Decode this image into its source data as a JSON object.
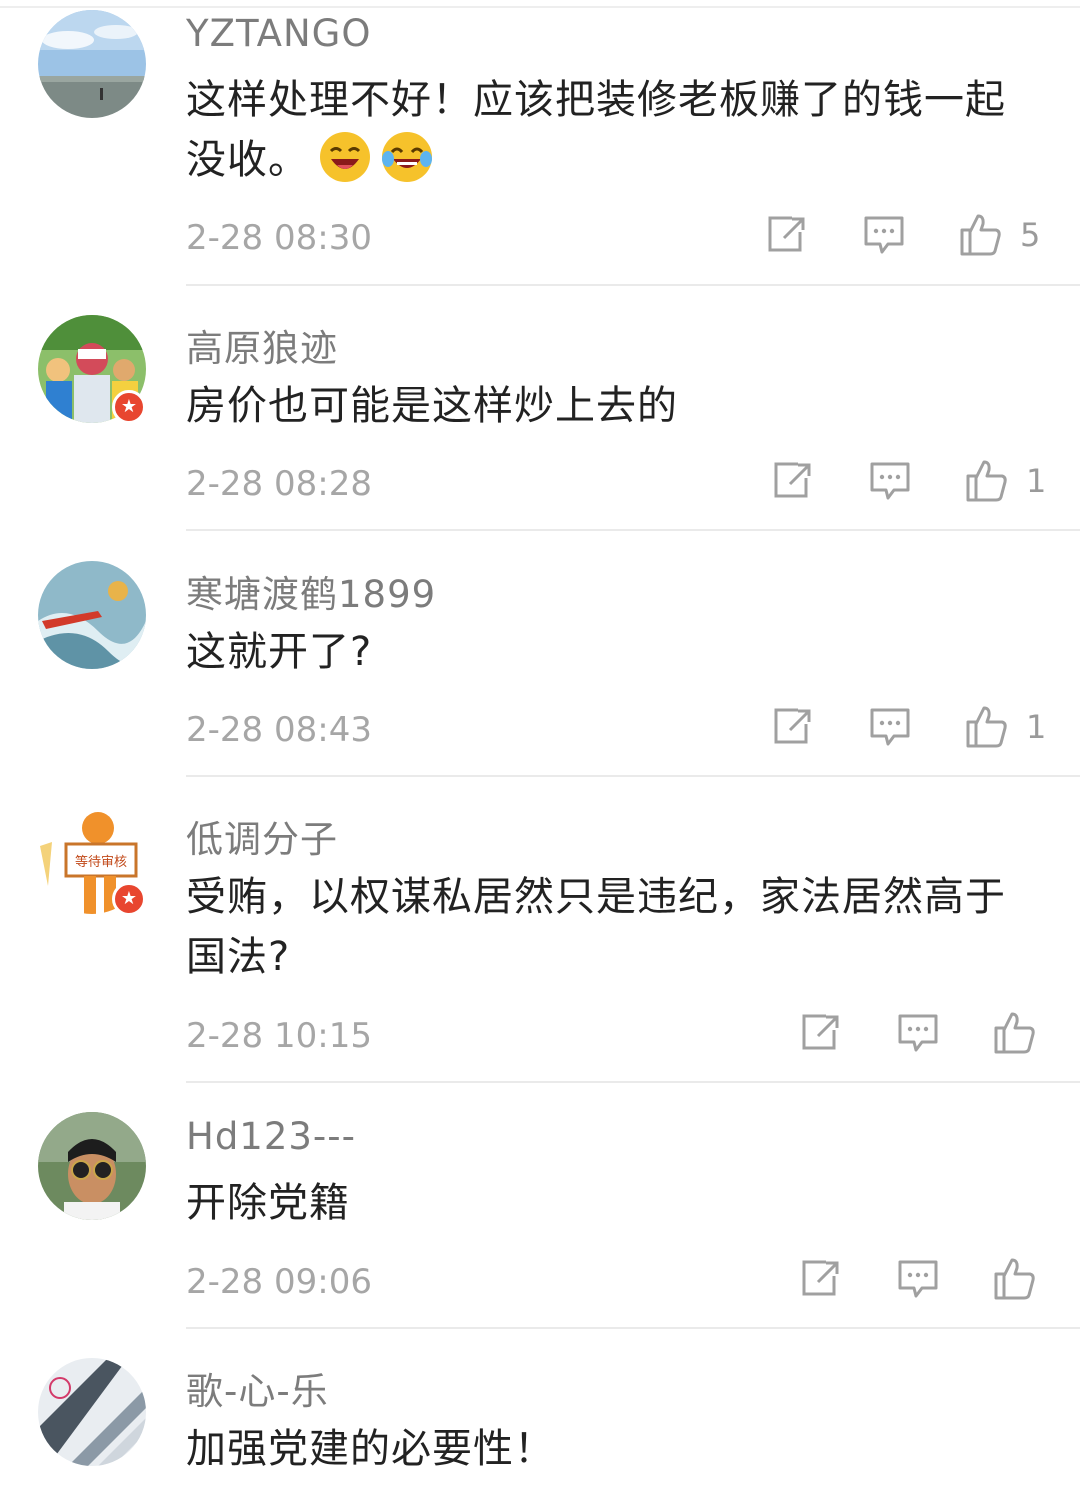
{
  "comments": [
    {
      "username": "YZTANGO",
      "text": "这样处理不好！应该把装修老板赚了的钱一起没收。",
      "time": "2-28 08:30",
      "likes": "5"
    },
    {
      "username": "高原狼迹",
      "text": "房价也可能是这样炒上去的",
      "time": "2-28 08:28",
      "likes": "1"
    },
    {
      "username": "寒塘渡鹤1899",
      "text": "这就开了?",
      "time": "2-28 08:43",
      "likes": "1"
    },
    {
      "username": "低调分子",
      "text": "受贿，以权谋私居然只是违纪，家法居然高于国法?",
      "time": "2-28 10:15",
      "likes": ""
    },
    {
      "username": "Hd123---",
      "text": "开除党籍",
      "time": "2-28 09:06",
      "likes": ""
    },
    {
      "username": "歌-心-乐",
      "text": "加强党建的必要性！",
      "time": "",
      "likes": ""
    }
  ],
  "avatar_badges": {
    "comment_2": "verified-badge",
    "comment_4": "verified-badge"
  },
  "avatar_sign_text": "等待审核",
  "icons": {
    "repost": "repost-icon",
    "reply": "reply-icon",
    "like": "like-icon"
  },
  "colors": {
    "badge": "#e8462f",
    "username": "#7c7c7c",
    "text": "#222222",
    "meta": "#a6a6a6"
  }
}
